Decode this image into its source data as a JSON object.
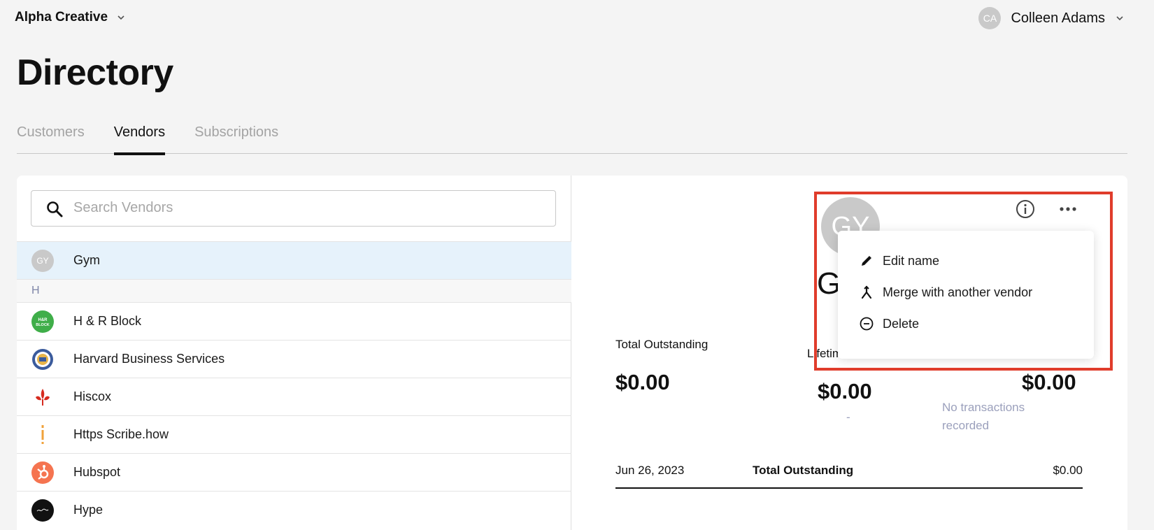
{
  "header": {
    "org_name": "Alpha Creative",
    "user_initials": "CA",
    "user_name": "Colleen Adams"
  },
  "page": {
    "title": "Directory",
    "tabs": [
      {
        "label": "Customers",
        "active": false
      },
      {
        "label": "Vendors",
        "active": true
      },
      {
        "label": "Subscriptions",
        "active": false
      }
    ]
  },
  "search": {
    "placeholder": "Search Vendors",
    "value": ""
  },
  "vendor_list": {
    "selected_item": {
      "initials": "GY",
      "name": "Gym"
    },
    "section_header": "H",
    "items": [
      {
        "name": "H & R Block",
        "logo": "hr-block-logo",
        "logo_text": "H&R BLOCK",
        "color": "#3fae49"
      },
      {
        "name": "Harvard Business Services",
        "logo": "harvard-seal-logo",
        "color": "#3b5b9c"
      },
      {
        "name": "Hiscox",
        "logo": "hiscox-fleur-logo",
        "color": "#d62b1f"
      },
      {
        "name": "Https Scribe.how",
        "logo": "scribe-logo",
        "color": "#f0a23a"
      },
      {
        "name": "Hubspot",
        "logo": "hubspot-logo",
        "color": "#f57450"
      },
      {
        "name": "Hype",
        "logo": "hype-logo",
        "color": "#111111"
      }
    ]
  },
  "detail": {
    "avatar_initials": "GY",
    "vendor_name": "Gym",
    "stats": {
      "total_outstanding_label": "Total Outstanding",
      "total_outstanding_value": "$0.00",
      "lifetime_cost_label": "Lifetime Cost",
      "lifetime_cost_value": "$0.00",
      "lifetime_cost_sub": "-",
      "third_value": "$0.00",
      "third_sub_line1": "No transactions",
      "third_sub_line2": "recorded"
    },
    "summary_row": {
      "date": "Jun 26, 2023",
      "label": "Total Outstanding",
      "amount": "$0.00"
    }
  },
  "context_menu": {
    "items": [
      {
        "label": "Edit name",
        "icon": "pencil-icon"
      },
      {
        "label": "Merge with another vendor",
        "icon": "merge-icon"
      },
      {
        "label": "Delete",
        "icon": "minus-circle-icon"
      }
    ]
  },
  "colors": {
    "highlight": "#e03c2b",
    "selected_row": "#e6f2fb",
    "muted_text": "#9ba0bc"
  }
}
